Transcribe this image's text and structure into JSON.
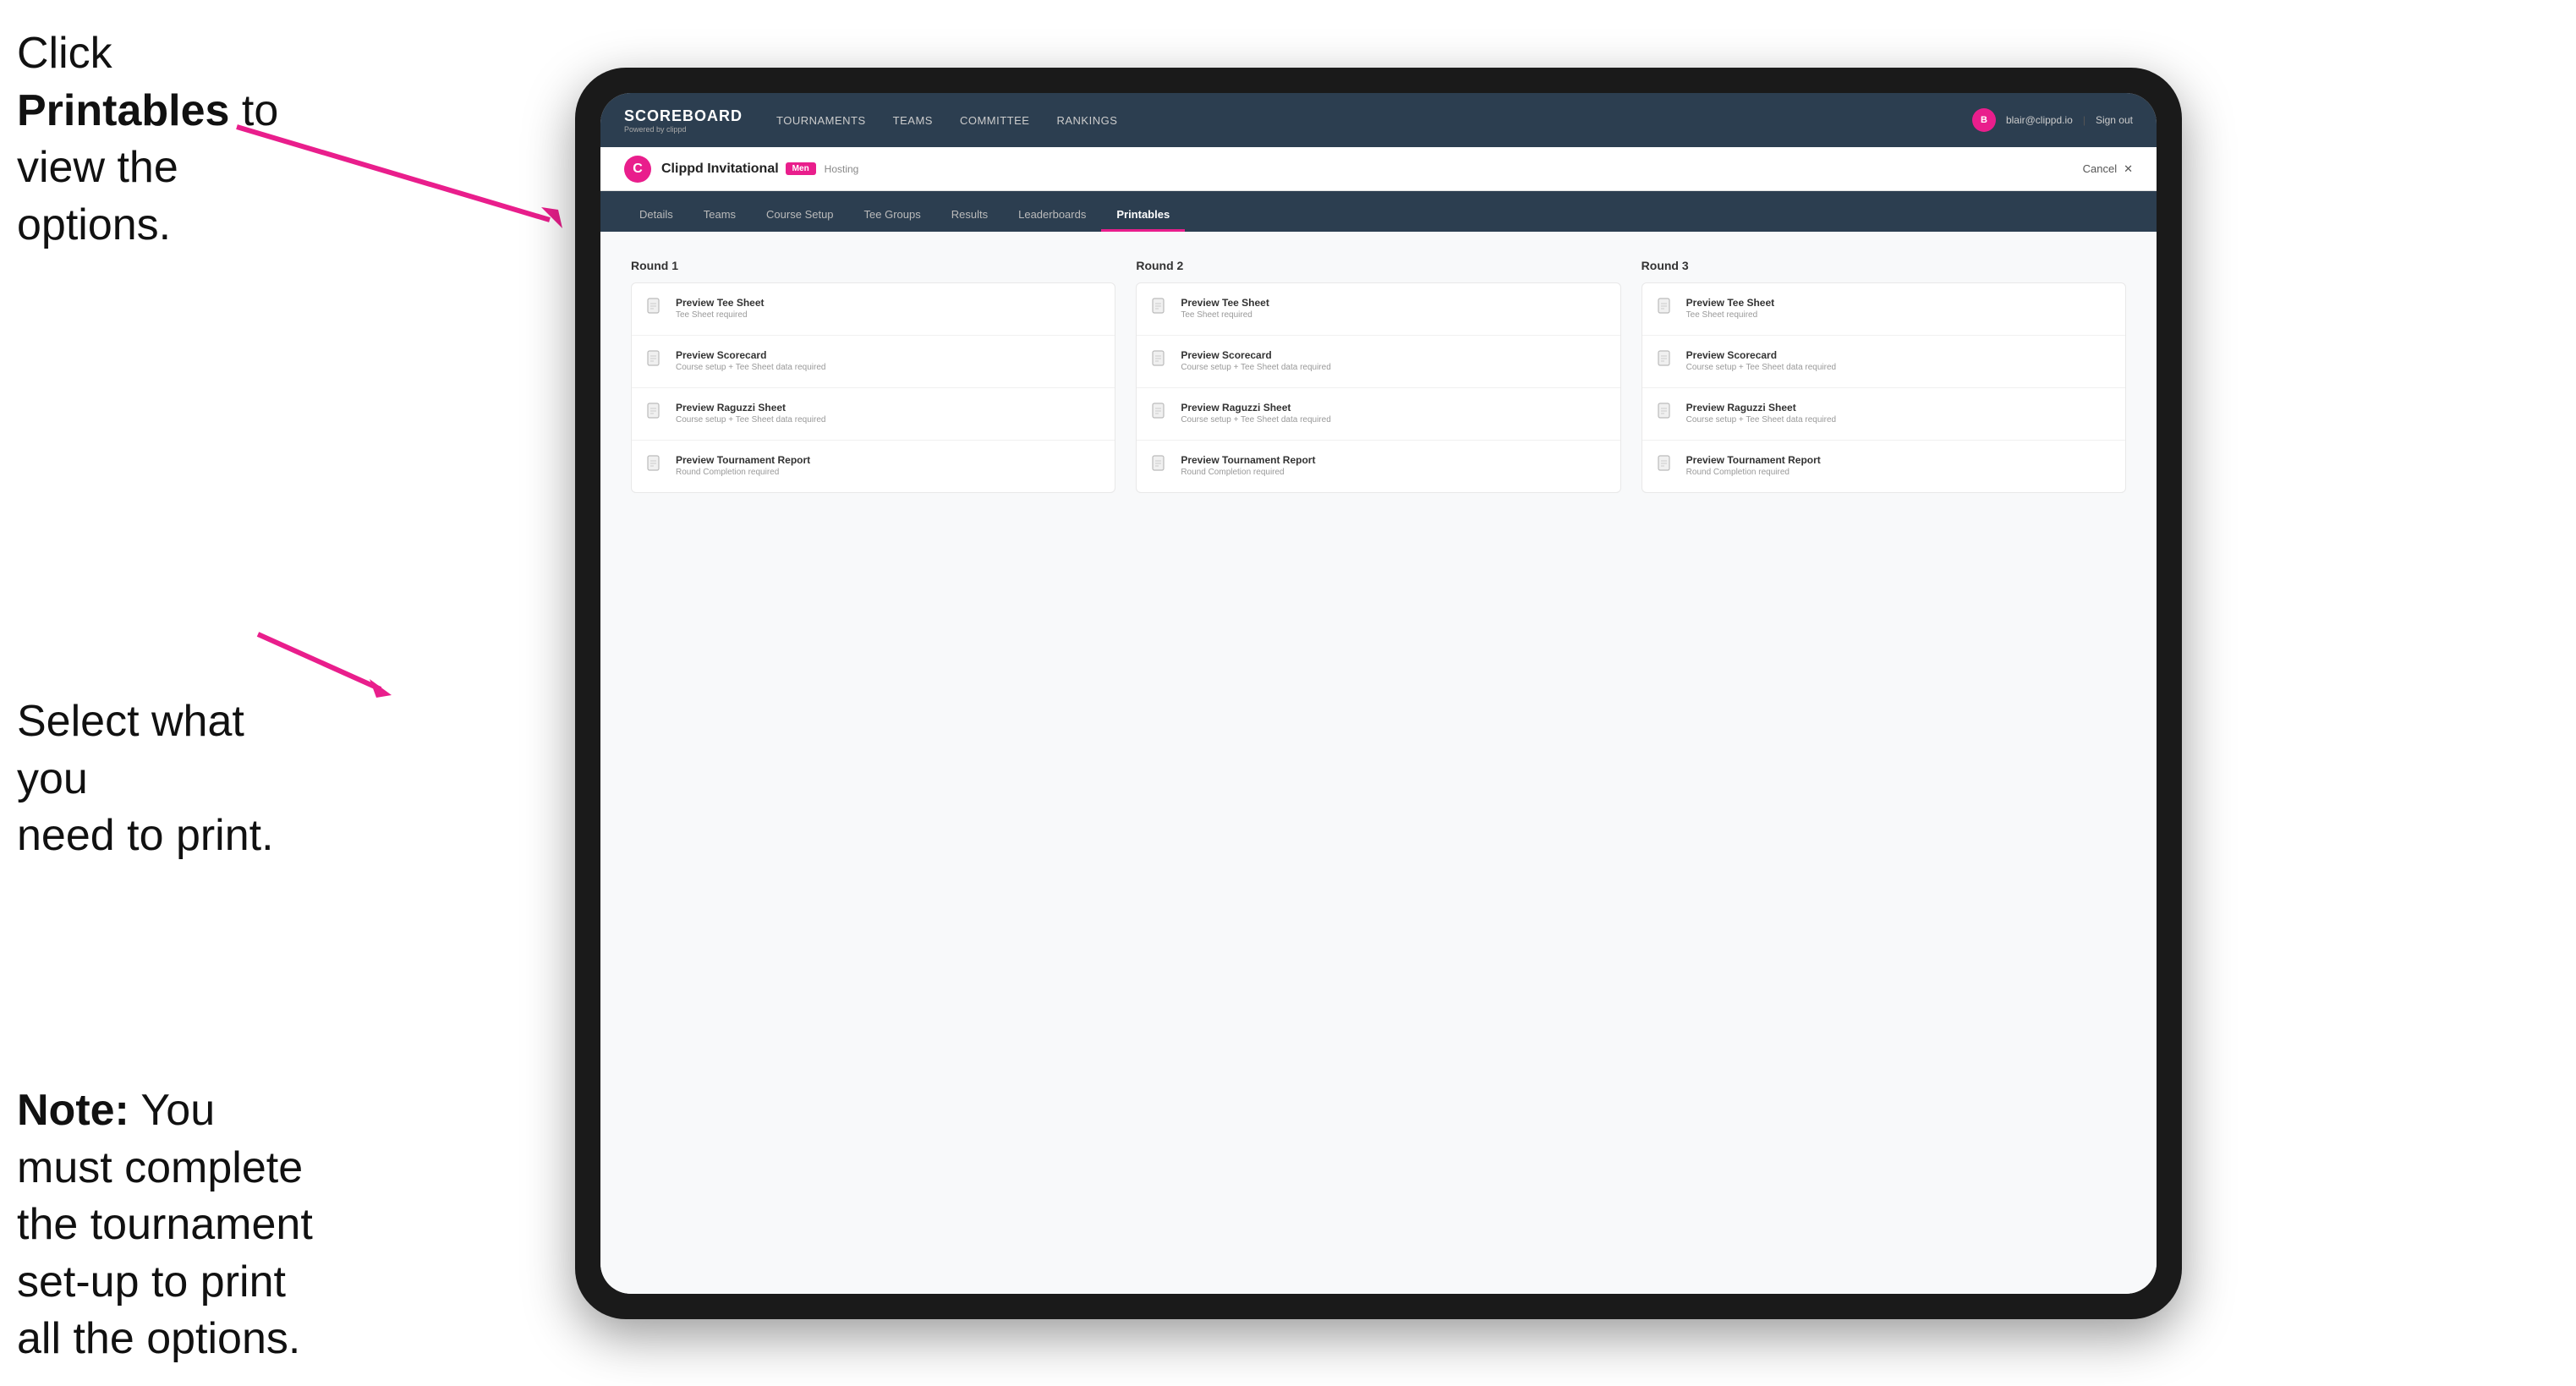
{
  "instructions": {
    "top_line1": "Click ",
    "top_bold": "Printables",
    "top_line2": " to",
    "top_line3": "view the options.",
    "middle_line1": "Select what you",
    "middle_line2": "need to print.",
    "bottom_bold": "Note:",
    "bottom_text": " You must complete the tournament set-up to print all the options."
  },
  "nav": {
    "brand": "SCOREBOARD",
    "brand_sub": "Powered by clippd",
    "links": [
      "TOURNAMENTS",
      "TEAMS",
      "COMMITTEE",
      "RANKINGS"
    ],
    "user_email": "blair@clippd.io",
    "sign_out": "Sign out",
    "separator": "|"
  },
  "sub_header": {
    "logo_letter": "C",
    "tournament_name": "Clippd Invitational",
    "badge": "Men",
    "status": "Hosting",
    "cancel": "Cancel",
    "cancel_icon": "✕"
  },
  "tabs": [
    {
      "label": "Details",
      "active": false
    },
    {
      "label": "Teams",
      "active": false
    },
    {
      "label": "Course Setup",
      "active": false
    },
    {
      "label": "Tee Groups",
      "active": false
    },
    {
      "label": "Results",
      "active": false
    },
    {
      "label": "Leaderboards",
      "active": false
    },
    {
      "label": "Printables",
      "active": true
    }
  ],
  "rounds": [
    {
      "title": "Round 1",
      "items": [
        {
          "title": "Preview Tee Sheet",
          "subtitle": "Tee Sheet required"
        },
        {
          "title": "Preview Scorecard",
          "subtitle": "Course setup + Tee Sheet data required"
        },
        {
          "title": "Preview Raguzzi Sheet",
          "subtitle": "Course setup + Tee Sheet data required"
        },
        {
          "title": "Preview Tournament Report",
          "subtitle": "Round Completion required"
        }
      ]
    },
    {
      "title": "Round 2",
      "items": [
        {
          "title": "Preview Tee Sheet",
          "subtitle": "Tee Sheet required"
        },
        {
          "title": "Preview Scorecard",
          "subtitle": "Course setup + Tee Sheet data required"
        },
        {
          "title": "Preview Raguzzi Sheet",
          "subtitle": "Course setup + Tee Sheet data required"
        },
        {
          "title": "Preview Tournament Report",
          "subtitle": "Round Completion required"
        }
      ]
    },
    {
      "title": "Round 3",
      "items": [
        {
          "title": "Preview Tee Sheet",
          "subtitle": "Tee Sheet required"
        },
        {
          "title": "Preview Scorecard",
          "subtitle": "Course setup + Tee Sheet data required"
        },
        {
          "title": "Preview Raguzzi Sheet",
          "subtitle": "Course setup + Tee Sheet data required"
        },
        {
          "title": "Preview Tournament Report",
          "subtitle": "Round Completion required"
        }
      ]
    }
  ],
  "colors": {
    "accent": "#e91e8c",
    "nav_bg": "#2c3e50",
    "tab_active_border": "#e91e8c"
  }
}
